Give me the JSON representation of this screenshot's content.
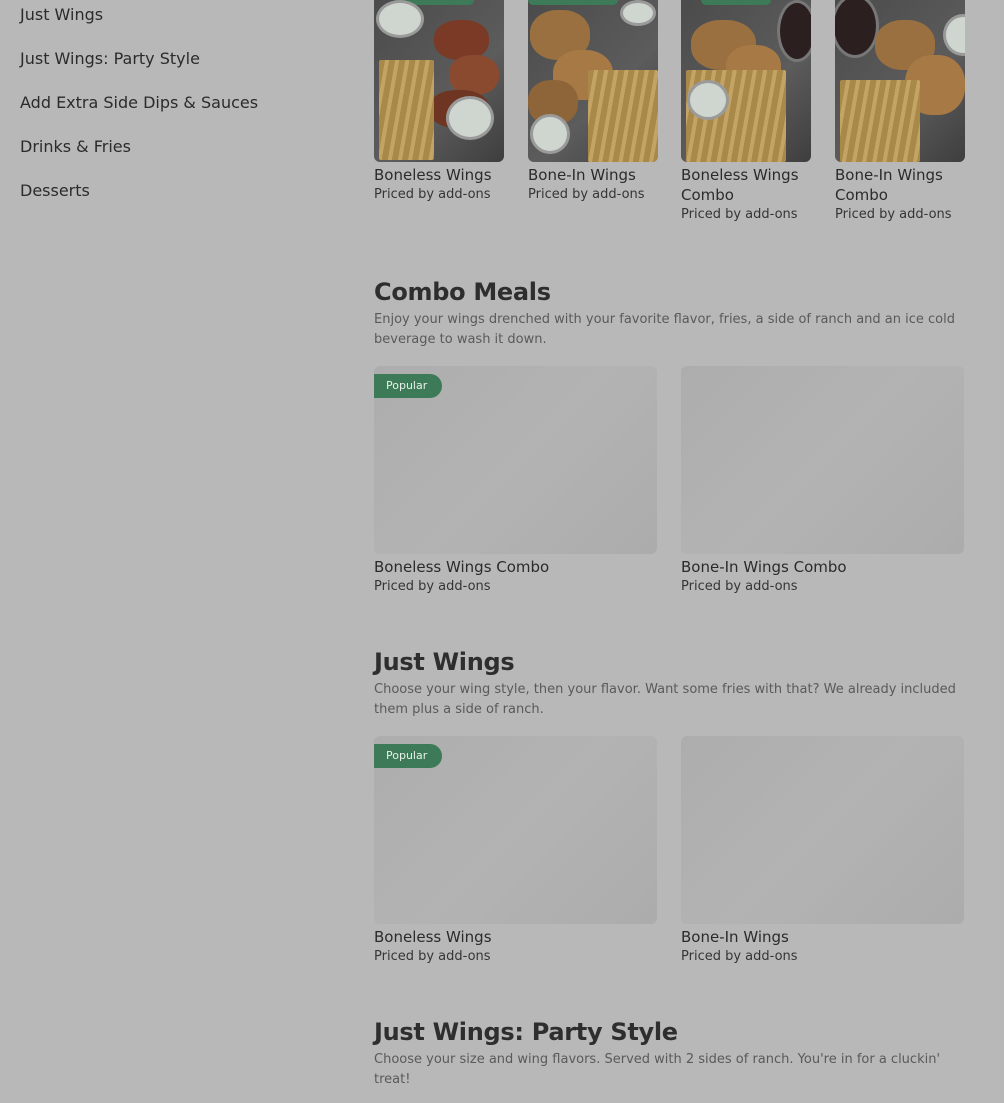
{
  "sidebar": {
    "items": [
      {
        "label": "Just Wings"
      },
      {
        "label": "Just Wings: Party Style"
      },
      {
        "label": "Add Extra Side Dips & Sauces"
      },
      {
        "label": "Drinks & Fries"
      },
      {
        "label": "Desserts"
      }
    ]
  },
  "top_row": {
    "cards": [
      {
        "name": "Boneless Wings",
        "price": "Priced by add-ons"
      },
      {
        "name": "Bone-In Wings",
        "price": "Priced by add-ons"
      },
      {
        "name": "Boneless Wings Combo",
        "price": "Priced by add-ons"
      },
      {
        "name": "Bone-In Wings Combo",
        "price": "Priced by add-ons"
      }
    ]
  },
  "combo_meals": {
    "title": "Combo Meals",
    "description": "Enjoy your wings drenched with your favorite flavor, fries, a side of ranch and an ice cold beverage to wash it down.",
    "badge": "Popular",
    "cards": [
      {
        "name": "Boneless Wings Combo",
        "price": "Priced by add-ons"
      },
      {
        "name": "Bone-In Wings Combo",
        "price": "Priced by add-ons"
      }
    ]
  },
  "just_wings": {
    "title": "Just Wings",
    "description": "Choose your wing style, then your flavor. Want some fries with that? We already included them plus a side of ranch.",
    "badge": "Popular",
    "cards": [
      {
        "name": "Boneless Wings",
        "price": "Priced by add-ons"
      },
      {
        "name": "Bone-In Wings",
        "price": "Priced by add-ons"
      }
    ]
  },
  "party_style": {
    "title": "Just Wings: Party Style",
    "description": "Choose your size and wing flavors. Served with 2 sides of ranch. You're in for a cluckin' treat!"
  },
  "colors": {
    "overlay_background": "#b8b8b8",
    "badge_green": "#3d7a57"
  }
}
